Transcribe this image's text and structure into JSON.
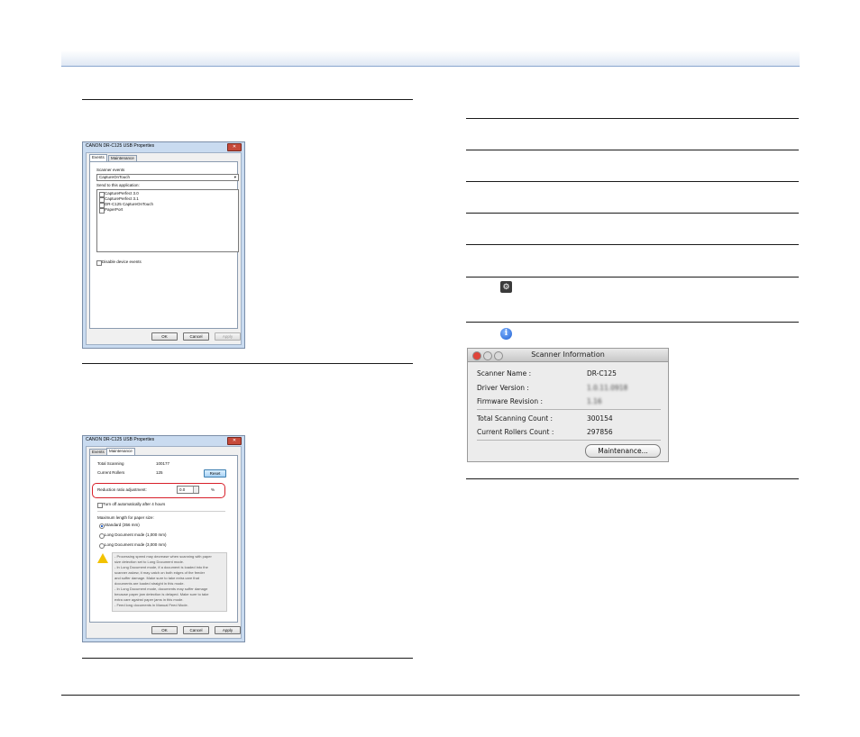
{
  "win1": {
    "title": "CANON DR-C125 USB Properties",
    "close": "✕",
    "tabs": [
      "Events",
      "Maintenance"
    ],
    "scanner_events_label": "Scanner events",
    "scanner_events_value": "CaptureOnTouch",
    "send_to_label": "Send to this application:",
    "apps": [
      "CapturePerfect 3.0",
      "CapturePerfect 3.1",
      "DR-C125 CaptureOnTouch",
      "PaperPort"
    ],
    "disable_label": "Disable device events",
    "ok": "OK",
    "cancel": "Cancel",
    "apply": "Apply"
  },
  "win2": {
    "title": "CANON DR-C125 USB Properties",
    "close": "✕",
    "tabs": [
      "Events",
      "Maintenance"
    ],
    "total_scanning_label": "Total Scanning",
    "total_scanning_value": "100177",
    "current_rollers_label": "Current Rollers",
    "current_rollers_value": "125",
    "reset": "Reset",
    "reduction_label": "Reduction ratio adjustment:",
    "reduction_value": "0.0",
    "reduction_unit": "%",
    "turn_off_label": "Turn off automatically after 4 hours",
    "max_length_label": "Maximum length for paper size:",
    "radio_options": [
      "Standard (356 mm)",
      "Long Document mode (1,000 mm)",
      "Long Document mode (3,000 mm)"
    ],
    "warning_lines": [
      "- Processing speed may decrease when scanning with paper",
      "  size detection set to Long Document mode.",
      "- In Long Document mode, if a document is loaded into the",
      "  scanner askew, it may catch on both edges of the feeder",
      "  and suffer damage. Make sure to take extra care that",
      "  documents are loaded straight in this mode.",
      "- In Long Document mode, documents may suffer damage",
      "  because paper jam detection is delayed. Make sure to take",
      "  extra care against paper jams in this mode.",
      "- Feed long documents in Manual Feed Mode."
    ],
    "ok": "OK",
    "cancel": "Cancel",
    "apply": "Apply"
  },
  "mac": {
    "title": "Scanner Information",
    "rows": [
      {
        "label": "Scanner Name :",
        "value": "DR-C125"
      },
      {
        "label": "Driver Version :",
        "value": "1.0.11.0918"
      },
      {
        "label": "Firmware Revision :",
        "value": "1.16"
      },
      {
        "label": "Total Scanning Count :",
        "value": "300154"
      },
      {
        "label": "Current Rollers Count :",
        "value": "297856"
      }
    ],
    "maintenance_button": "Maintenance..."
  },
  "icons": {
    "gear": "⚙",
    "info": "i"
  }
}
